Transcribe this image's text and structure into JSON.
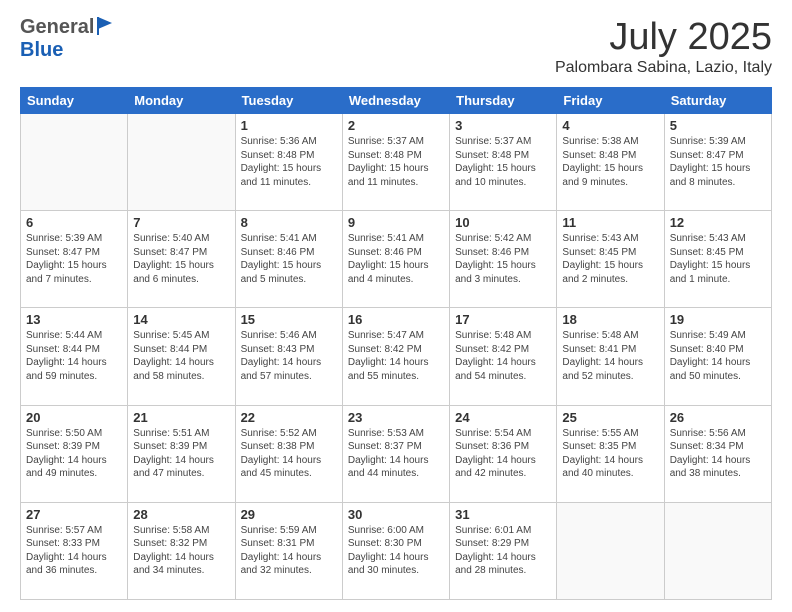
{
  "header": {
    "logo_general": "General",
    "logo_blue": "Blue",
    "month_title": "July 2025",
    "location": "Palombara Sabina, Lazio, Italy"
  },
  "weekdays": [
    "Sunday",
    "Monday",
    "Tuesday",
    "Wednesday",
    "Thursday",
    "Friday",
    "Saturday"
  ],
  "weeks": [
    [
      {
        "day": "",
        "sunrise": "",
        "sunset": "",
        "daylight": ""
      },
      {
        "day": "",
        "sunrise": "",
        "sunset": "",
        "daylight": ""
      },
      {
        "day": "1",
        "sunrise": "Sunrise: 5:36 AM",
        "sunset": "Sunset: 8:48 PM",
        "daylight": "Daylight: 15 hours and 11 minutes."
      },
      {
        "day": "2",
        "sunrise": "Sunrise: 5:37 AM",
        "sunset": "Sunset: 8:48 PM",
        "daylight": "Daylight: 15 hours and 11 minutes."
      },
      {
        "day": "3",
        "sunrise": "Sunrise: 5:37 AM",
        "sunset": "Sunset: 8:48 PM",
        "daylight": "Daylight: 15 hours and 10 minutes."
      },
      {
        "day": "4",
        "sunrise": "Sunrise: 5:38 AM",
        "sunset": "Sunset: 8:48 PM",
        "daylight": "Daylight: 15 hours and 9 minutes."
      },
      {
        "day": "5",
        "sunrise": "Sunrise: 5:39 AM",
        "sunset": "Sunset: 8:47 PM",
        "daylight": "Daylight: 15 hours and 8 minutes."
      }
    ],
    [
      {
        "day": "6",
        "sunrise": "Sunrise: 5:39 AM",
        "sunset": "Sunset: 8:47 PM",
        "daylight": "Daylight: 15 hours and 7 minutes."
      },
      {
        "day": "7",
        "sunrise": "Sunrise: 5:40 AM",
        "sunset": "Sunset: 8:47 PM",
        "daylight": "Daylight: 15 hours and 6 minutes."
      },
      {
        "day": "8",
        "sunrise": "Sunrise: 5:41 AM",
        "sunset": "Sunset: 8:46 PM",
        "daylight": "Daylight: 15 hours and 5 minutes."
      },
      {
        "day": "9",
        "sunrise": "Sunrise: 5:41 AM",
        "sunset": "Sunset: 8:46 PM",
        "daylight": "Daylight: 15 hours and 4 minutes."
      },
      {
        "day": "10",
        "sunrise": "Sunrise: 5:42 AM",
        "sunset": "Sunset: 8:46 PM",
        "daylight": "Daylight: 15 hours and 3 minutes."
      },
      {
        "day": "11",
        "sunrise": "Sunrise: 5:43 AM",
        "sunset": "Sunset: 8:45 PM",
        "daylight": "Daylight: 15 hours and 2 minutes."
      },
      {
        "day": "12",
        "sunrise": "Sunrise: 5:43 AM",
        "sunset": "Sunset: 8:45 PM",
        "daylight": "Daylight: 15 hours and 1 minute."
      }
    ],
    [
      {
        "day": "13",
        "sunrise": "Sunrise: 5:44 AM",
        "sunset": "Sunset: 8:44 PM",
        "daylight": "Daylight: 14 hours and 59 minutes."
      },
      {
        "day": "14",
        "sunrise": "Sunrise: 5:45 AM",
        "sunset": "Sunset: 8:44 PM",
        "daylight": "Daylight: 14 hours and 58 minutes."
      },
      {
        "day": "15",
        "sunrise": "Sunrise: 5:46 AM",
        "sunset": "Sunset: 8:43 PM",
        "daylight": "Daylight: 14 hours and 57 minutes."
      },
      {
        "day": "16",
        "sunrise": "Sunrise: 5:47 AM",
        "sunset": "Sunset: 8:42 PM",
        "daylight": "Daylight: 14 hours and 55 minutes."
      },
      {
        "day": "17",
        "sunrise": "Sunrise: 5:48 AM",
        "sunset": "Sunset: 8:42 PM",
        "daylight": "Daylight: 14 hours and 54 minutes."
      },
      {
        "day": "18",
        "sunrise": "Sunrise: 5:48 AM",
        "sunset": "Sunset: 8:41 PM",
        "daylight": "Daylight: 14 hours and 52 minutes."
      },
      {
        "day": "19",
        "sunrise": "Sunrise: 5:49 AM",
        "sunset": "Sunset: 8:40 PM",
        "daylight": "Daylight: 14 hours and 50 minutes."
      }
    ],
    [
      {
        "day": "20",
        "sunrise": "Sunrise: 5:50 AM",
        "sunset": "Sunset: 8:39 PM",
        "daylight": "Daylight: 14 hours and 49 minutes."
      },
      {
        "day": "21",
        "sunrise": "Sunrise: 5:51 AM",
        "sunset": "Sunset: 8:39 PM",
        "daylight": "Daylight: 14 hours and 47 minutes."
      },
      {
        "day": "22",
        "sunrise": "Sunrise: 5:52 AM",
        "sunset": "Sunset: 8:38 PM",
        "daylight": "Daylight: 14 hours and 45 minutes."
      },
      {
        "day": "23",
        "sunrise": "Sunrise: 5:53 AM",
        "sunset": "Sunset: 8:37 PM",
        "daylight": "Daylight: 14 hours and 44 minutes."
      },
      {
        "day": "24",
        "sunrise": "Sunrise: 5:54 AM",
        "sunset": "Sunset: 8:36 PM",
        "daylight": "Daylight: 14 hours and 42 minutes."
      },
      {
        "day": "25",
        "sunrise": "Sunrise: 5:55 AM",
        "sunset": "Sunset: 8:35 PM",
        "daylight": "Daylight: 14 hours and 40 minutes."
      },
      {
        "day": "26",
        "sunrise": "Sunrise: 5:56 AM",
        "sunset": "Sunset: 8:34 PM",
        "daylight": "Daylight: 14 hours and 38 minutes."
      }
    ],
    [
      {
        "day": "27",
        "sunrise": "Sunrise: 5:57 AM",
        "sunset": "Sunset: 8:33 PM",
        "daylight": "Daylight: 14 hours and 36 minutes."
      },
      {
        "day": "28",
        "sunrise": "Sunrise: 5:58 AM",
        "sunset": "Sunset: 8:32 PM",
        "daylight": "Daylight: 14 hours and 34 minutes."
      },
      {
        "day": "29",
        "sunrise": "Sunrise: 5:59 AM",
        "sunset": "Sunset: 8:31 PM",
        "daylight": "Daylight: 14 hours and 32 minutes."
      },
      {
        "day": "30",
        "sunrise": "Sunrise: 6:00 AM",
        "sunset": "Sunset: 8:30 PM",
        "daylight": "Daylight: 14 hours and 30 minutes."
      },
      {
        "day": "31",
        "sunrise": "Sunrise: 6:01 AM",
        "sunset": "Sunset: 8:29 PM",
        "daylight": "Daylight: 14 hours and 28 minutes."
      },
      {
        "day": "",
        "sunrise": "",
        "sunset": "",
        "daylight": ""
      },
      {
        "day": "",
        "sunrise": "",
        "sunset": "",
        "daylight": ""
      }
    ]
  ]
}
